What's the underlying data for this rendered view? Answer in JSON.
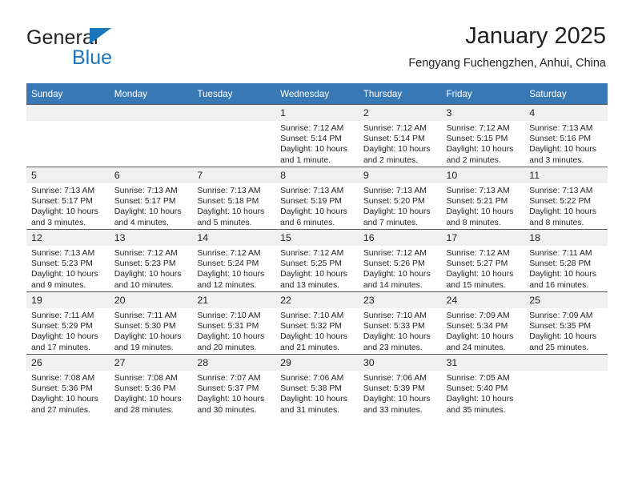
{
  "brand": {
    "name_top": "General",
    "name_bottom": "Blue",
    "accent_color": "#1b75bb"
  },
  "header": {
    "title": "January 2025",
    "subtitle": "Fengyang Fuchengzhen, Anhui, China"
  },
  "theme": {
    "header_row_bg": "#3878b4",
    "daynum_bg": "#f0f0f0",
    "cell_border": "#595959",
    "text_color": "#231f20"
  },
  "calendar": {
    "weekday_headers": [
      "Sunday",
      "Monday",
      "Tuesday",
      "Wednesday",
      "Thursday",
      "Friday",
      "Saturday"
    ],
    "weeks": [
      [
        {
          "day": "",
          "lines": []
        },
        {
          "day": "",
          "lines": []
        },
        {
          "day": "",
          "lines": []
        },
        {
          "day": "1",
          "lines": [
            "Sunrise: 7:12 AM",
            "Sunset: 5:14 PM",
            "Daylight: 10 hours and 1 minute."
          ]
        },
        {
          "day": "2",
          "lines": [
            "Sunrise: 7:12 AM",
            "Sunset: 5:14 PM",
            "Daylight: 10 hours and 2 minutes."
          ]
        },
        {
          "day": "3",
          "lines": [
            "Sunrise: 7:12 AM",
            "Sunset: 5:15 PM",
            "Daylight: 10 hours and 2 minutes."
          ]
        },
        {
          "day": "4",
          "lines": [
            "Sunrise: 7:13 AM",
            "Sunset: 5:16 PM",
            "Daylight: 10 hours and 3 minutes."
          ]
        }
      ],
      [
        {
          "day": "5",
          "lines": [
            "Sunrise: 7:13 AM",
            "Sunset: 5:17 PM",
            "Daylight: 10 hours and 3 minutes."
          ]
        },
        {
          "day": "6",
          "lines": [
            "Sunrise: 7:13 AM",
            "Sunset: 5:17 PM",
            "Daylight: 10 hours and 4 minutes."
          ]
        },
        {
          "day": "7",
          "lines": [
            "Sunrise: 7:13 AM",
            "Sunset: 5:18 PM",
            "Daylight: 10 hours and 5 minutes."
          ]
        },
        {
          "day": "8",
          "lines": [
            "Sunrise: 7:13 AM",
            "Sunset: 5:19 PM",
            "Daylight: 10 hours and 6 minutes."
          ]
        },
        {
          "day": "9",
          "lines": [
            "Sunrise: 7:13 AM",
            "Sunset: 5:20 PM",
            "Daylight: 10 hours and 7 minutes."
          ]
        },
        {
          "day": "10",
          "lines": [
            "Sunrise: 7:13 AM",
            "Sunset: 5:21 PM",
            "Daylight: 10 hours and 8 minutes."
          ]
        },
        {
          "day": "11",
          "lines": [
            "Sunrise: 7:13 AM",
            "Sunset: 5:22 PM",
            "Daylight: 10 hours and 8 minutes."
          ]
        }
      ],
      [
        {
          "day": "12",
          "lines": [
            "Sunrise: 7:13 AM",
            "Sunset: 5:23 PM",
            "Daylight: 10 hours and 9 minutes."
          ]
        },
        {
          "day": "13",
          "lines": [
            "Sunrise: 7:12 AM",
            "Sunset: 5:23 PM",
            "Daylight: 10 hours and 10 minutes."
          ]
        },
        {
          "day": "14",
          "lines": [
            "Sunrise: 7:12 AM",
            "Sunset: 5:24 PM",
            "Daylight: 10 hours and 12 minutes."
          ]
        },
        {
          "day": "15",
          "lines": [
            "Sunrise: 7:12 AM",
            "Sunset: 5:25 PM",
            "Daylight: 10 hours and 13 minutes."
          ]
        },
        {
          "day": "16",
          "lines": [
            "Sunrise: 7:12 AM",
            "Sunset: 5:26 PM",
            "Daylight: 10 hours and 14 minutes."
          ]
        },
        {
          "day": "17",
          "lines": [
            "Sunrise: 7:12 AM",
            "Sunset: 5:27 PM",
            "Daylight: 10 hours and 15 minutes."
          ]
        },
        {
          "day": "18",
          "lines": [
            "Sunrise: 7:11 AM",
            "Sunset: 5:28 PM",
            "Daylight: 10 hours and 16 minutes."
          ]
        }
      ],
      [
        {
          "day": "19",
          "lines": [
            "Sunrise: 7:11 AM",
            "Sunset: 5:29 PM",
            "Daylight: 10 hours and 17 minutes."
          ]
        },
        {
          "day": "20",
          "lines": [
            "Sunrise: 7:11 AM",
            "Sunset: 5:30 PM",
            "Daylight: 10 hours and 19 minutes."
          ]
        },
        {
          "day": "21",
          "lines": [
            "Sunrise: 7:10 AM",
            "Sunset: 5:31 PM",
            "Daylight: 10 hours and 20 minutes."
          ]
        },
        {
          "day": "22",
          "lines": [
            "Sunrise: 7:10 AM",
            "Sunset: 5:32 PM",
            "Daylight: 10 hours and 21 minutes."
          ]
        },
        {
          "day": "23",
          "lines": [
            "Sunrise: 7:10 AM",
            "Sunset: 5:33 PM",
            "Daylight: 10 hours and 23 minutes."
          ]
        },
        {
          "day": "24",
          "lines": [
            "Sunrise: 7:09 AM",
            "Sunset: 5:34 PM",
            "Daylight: 10 hours and 24 minutes."
          ]
        },
        {
          "day": "25",
          "lines": [
            "Sunrise: 7:09 AM",
            "Sunset: 5:35 PM",
            "Daylight: 10 hours and 25 minutes."
          ]
        }
      ],
      [
        {
          "day": "26",
          "lines": [
            "Sunrise: 7:08 AM",
            "Sunset: 5:36 PM",
            "Daylight: 10 hours and 27 minutes."
          ]
        },
        {
          "day": "27",
          "lines": [
            "Sunrise: 7:08 AM",
            "Sunset: 5:36 PM",
            "Daylight: 10 hours and 28 minutes."
          ]
        },
        {
          "day": "28",
          "lines": [
            "Sunrise: 7:07 AM",
            "Sunset: 5:37 PM",
            "Daylight: 10 hours and 30 minutes."
          ]
        },
        {
          "day": "29",
          "lines": [
            "Sunrise: 7:06 AM",
            "Sunset: 5:38 PM",
            "Daylight: 10 hours and 31 minutes."
          ]
        },
        {
          "day": "30",
          "lines": [
            "Sunrise: 7:06 AM",
            "Sunset: 5:39 PM",
            "Daylight: 10 hours and 33 minutes."
          ]
        },
        {
          "day": "31",
          "lines": [
            "Sunrise: 7:05 AM",
            "Sunset: 5:40 PM",
            "Daylight: 10 hours and 35 minutes."
          ]
        },
        {
          "day": "",
          "lines": []
        }
      ]
    ]
  }
}
